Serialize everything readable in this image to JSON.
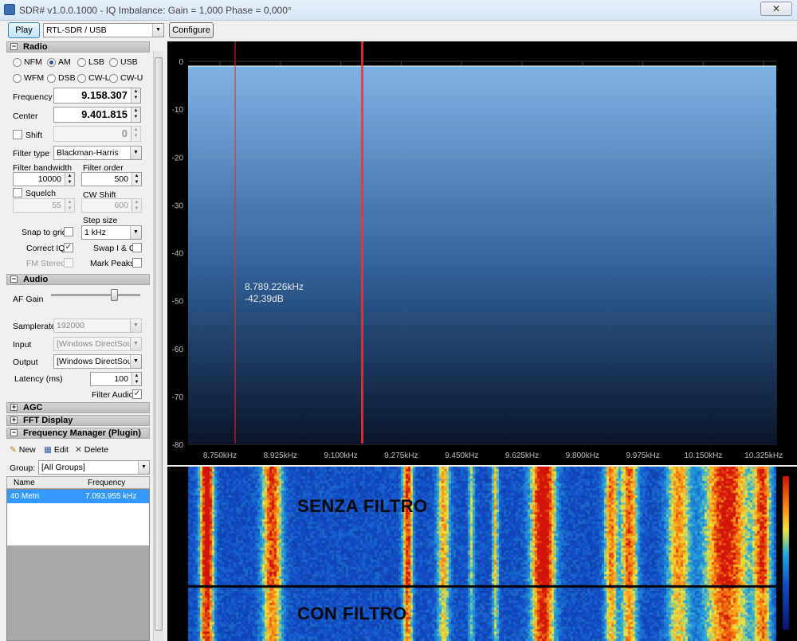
{
  "window": {
    "title": "SDR# v1.0.0.1000 - IQ Imbalance: Gain = 1,000 Phase = 0,000°"
  },
  "toolbar": {
    "play_label": "Play",
    "source": "RTL-SDR / USB",
    "configure_label": "Configure"
  },
  "radio": {
    "section_title": "Radio",
    "modes": [
      {
        "label": "NFM",
        "selected": false
      },
      {
        "label": "AM",
        "selected": true
      },
      {
        "label": "LSB",
        "selected": false
      },
      {
        "label": "USB",
        "selected": false
      },
      {
        "label": "WFM",
        "selected": false
      },
      {
        "label": "DSB",
        "selected": false
      },
      {
        "label": "CW-L",
        "selected": false
      },
      {
        "label": "CW-U",
        "selected": false
      }
    ],
    "frequency_label": "Frequency",
    "frequency_value": "9.158.307",
    "center_label": "Center",
    "center_value": "9.401.815",
    "shift_label": "Shift",
    "shift_value": "0",
    "filter_type_label": "Filter type",
    "filter_type_value": "Blackman-Harris",
    "filter_bandwidth_label": "Filter bandwidth",
    "filter_bandwidth_value": "10000",
    "filter_order_label": "Filter order",
    "filter_order_value": "500",
    "squelch_label": "Squelch",
    "squelch_value": "55",
    "cw_shift_label": "CW Shift",
    "cw_shift_value": "600",
    "step_size_label": "Step size",
    "step_size_value": "1 kHz",
    "snap_to_grid_label": "Snap to grid",
    "correct_iq_label": "Correct IQ",
    "correct_iq_checked": "✓",
    "swap_iq_label": "Swap I & Q",
    "fm_stereo_label": "FM Stereo",
    "mark_peaks_label": "Mark Peaks"
  },
  "audio": {
    "section_title": "Audio",
    "af_gain_label": "AF Gain",
    "af_gain_level": 0.72,
    "samplerate_label": "Samplerate",
    "samplerate_value": "192000",
    "input_label": "Input",
    "input_value": "[Windows DirectSound]",
    "output_label": "Output",
    "output_value": "[Windows DirectSound]",
    "latency_label": "Latency (ms)",
    "latency_value": "100",
    "filter_audio_label": "Filter Audio",
    "filter_audio_checked": "✓"
  },
  "sections": {
    "agc": "AGC",
    "fft": "FFT Display",
    "freq_manager": "Frequency Manager (Plugin)"
  },
  "freq_manager": {
    "new_label": "New",
    "edit_label": "Edit",
    "delete_label": "Delete",
    "group_label": "Group:",
    "group_value": "[All Groups]",
    "col_name": "Name",
    "col_frequency": "Frequency",
    "rows": [
      {
        "name": "40 Metri",
        "frequency": "7.093.955 kHz"
      }
    ]
  },
  "spectrum": {
    "cursor_freq": "8.789.226kHz",
    "cursor_level": "-42,39dB",
    "y_ticks": [
      "0",
      "-10",
      "-20",
      "-30",
      "-40",
      "-50",
      "-60",
      "-70",
      "-80"
    ],
    "x_ticks": [
      "8.750kHz",
      "8.925kHz",
      "9.100kHz",
      "9.275kHz",
      "9.450kHz",
      "9.625kHz",
      "9.800kHz",
      "9.975kHz",
      "10.150kHz",
      "10.325kHz"
    ]
  },
  "waterfall": {
    "label_top": "SENZA FILTRO",
    "label_bottom": "CON FILTRO"
  },
  "colors": {
    "spectrum_bg": "#000000",
    "trace": "#ffffff",
    "fill_top": "#6fa8dc",
    "cursor_red": "#ff2020",
    "selection": "#3399ff"
  }
}
